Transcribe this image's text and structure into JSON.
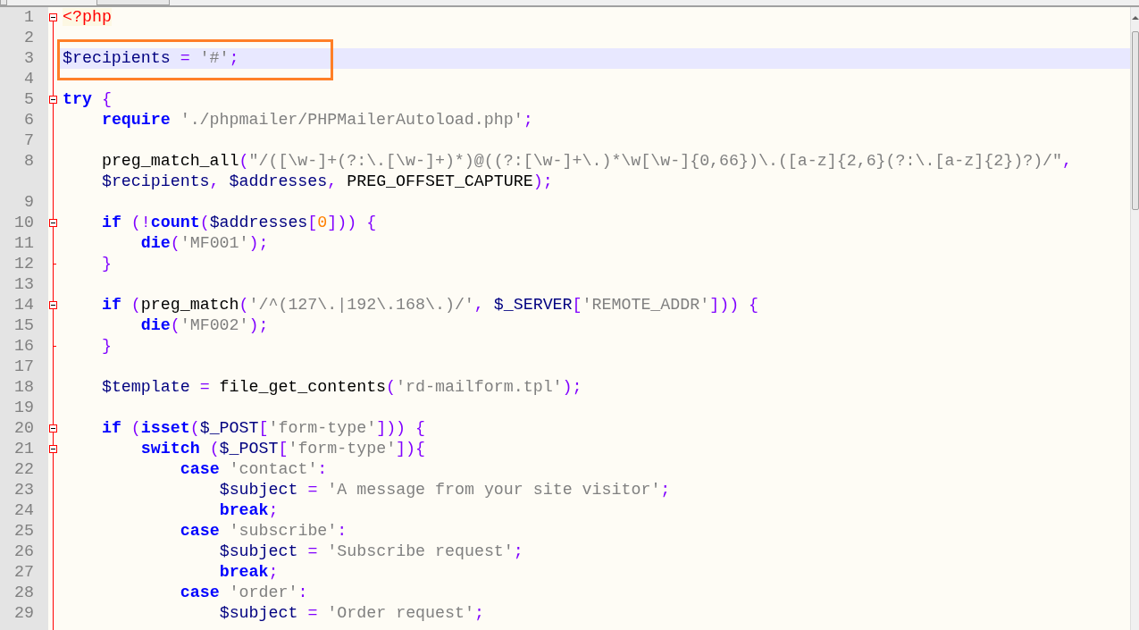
{
  "rows": [
    {
      "number": "1",
      "kind": "fold_start",
      "tokens": [
        {
          "kind": "tag",
          "text": "<?php"
        }
      ]
    },
    {
      "number": "2"
    },
    {
      "number": "3",
      "current": true,
      "boxed": true,
      "tokens": [
        {
          "kind": "var",
          "text": "$recipients"
        },
        {
          "kind": "op",
          "text": " ="
        },
        {
          "kind": "str",
          "text": " '#'"
        },
        {
          "kind": "op",
          "text": ";"
        }
      ]
    },
    {
      "number": "4"
    },
    {
      "number": "5",
      "kind": "fold_start",
      "tokens": [
        {
          "kind": "kw",
          "text": "try"
        },
        {
          "kind": "op",
          "text": " {"
        }
      ],
      "children": [
        {
          "number": "6",
          "tokens": [
            {
              "kind": "kw",
              "text": "require"
            },
            {
              "kind": "str",
              "text": " './phpmailer/PHPMailerAutoload.php'"
            },
            {
              "kind": "op",
              "text": ";"
            }
          ]
        },
        {
          "number": "7"
        },
        {
          "number": "8",
          "tokens": [
            {
              "kind": "plain",
              "text": "preg_match_all"
            },
            {
              "kind": "op",
              "text": "("
            },
            {
              "kind": "str",
              "text": "\"/([\\w-]+(?:\\.[\\w-]+)*)@((?:[\\w-]+\\.)*\\w[\\w-]{0,66})\\.([a-z]{2,6}(?:\\.[a-z]{2})?)/\""
            },
            {
              "kind": "op",
              "text": ","
            }
          ]
        },
        {
          "tokens": [
            {
              "kind": "var",
              "text": "$recipients"
            },
            {
              "kind": "op",
              "text": ","
            },
            {
              "kind": "var",
              "text": " $addresses"
            },
            {
              "kind": "op",
              "text": ","
            },
            {
              "kind": "plain",
              "text": " PREG_OFFSET_CAPTURE"
            },
            {
              "kind": "op",
              "text": ");"
            }
          ]
        },
        {
          "number": "9"
        },
        {
          "number": "10",
          "kind": "fold_start",
          "tokens": [
            {
              "kind": "kw",
              "text": "if"
            },
            {
              "kind": "op",
              "text": " (!"
            },
            {
              "kind": "kw",
              "text": "count"
            },
            {
              "kind": "op",
              "text": "("
            },
            {
              "kind": "var",
              "text": "$addresses"
            },
            {
              "kind": "op",
              "text": "["
            },
            {
              "kind": "num",
              "text": "0"
            },
            {
              "kind": "op",
              "text": "])) {"
            }
          ],
          "children": [
            {
              "number": "11",
              "tokens": [
                {
                  "kind": "kw",
                  "text": "die"
                },
                {
                  "kind": "op",
                  "text": "("
                },
                {
                  "kind": "str",
                  "text": "'MF001'"
                },
                {
                  "kind": "op",
                  "text": ");"
                }
              ]
            }
          ]
        },
        {
          "number": "12",
          "kind": "fold_end",
          "tokens": [
            {
              "kind": "op",
              "text": "}"
            }
          ]
        },
        {
          "number": "13"
        },
        {
          "number": "14",
          "kind": "fold_start",
          "tokens": [
            {
              "kind": "kw",
              "text": "if"
            },
            {
              "kind": "op",
              "text": " ("
            },
            {
              "kind": "plain",
              "text": "preg_match"
            },
            {
              "kind": "op",
              "text": "("
            },
            {
              "kind": "str",
              "text": "'/^(127\\.|192\\.168\\.)/'"
            },
            {
              "kind": "op",
              "text": ","
            },
            {
              "kind": "var",
              "text": " $_SERVER"
            },
            {
              "kind": "op",
              "text": "["
            },
            {
              "kind": "str",
              "text": "'REMOTE_ADDR'"
            },
            {
              "kind": "op",
              "text": "])) {"
            }
          ],
          "children": [
            {
              "number": "15",
              "tokens": [
                {
                  "kind": "kw",
                  "text": "die"
                },
                {
                  "kind": "op",
                  "text": "("
                },
                {
                  "kind": "str",
                  "text": "'MF002'"
                },
                {
                  "kind": "op",
                  "text": ");"
                }
              ]
            }
          ]
        },
        {
          "number": "16",
          "kind": "fold_end",
          "tokens": [
            {
              "kind": "op",
              "text": "}"
            }
          ]
        },
        {
          "number": "17"
        },
        {
          "number": "18",
          "tokens": [
            {
              "kind": "var",
              "text": "$template"
            },
            {
              "kind": "op",
              "text": " ="
            },
            {
              "kind": "plain",
              "text": " file_get_contents"
            },
            {
              "kind": "op",
              "text": "("
            },
            {
              "kind": "str",
              "text": "'rd-mailform.tpl'"
            },
            {
              "kind": "op",
              "text": ");"
            }
          ]
        },
        {
          "number": "19"
        },
        {
          "number": "20",
          "kind": "fold_start",
          "tokens": [
            {
              "kind": "kw",
              "text": "if"
            },
            {
              "kind": "op",
              "text": " ("
            },
            {
              "kind": "kw",
              "text": "isset"
            },
            {
              "kind": "op",
              "text": "("
            },
            {
              "kind": "var",
              "text": "$_POST"
            },
            {
              "kind": "op",
              "text": "["
            },
            {
              "kind": "str",
              "text": "'form-type'"
            },
            {
              "kind": "op",
              "text": "])) {"
            }
          ],
          "children": [
            {
              "number": "21",
              "kind": "fold_start",
              "tokens": [
                {
                  "kind": "kw",
                  "text": "switch"
                },
                {
                  "kind": "op",
                  "text": " ("
                },
                {
                  "kind": "var",
                  "text": "$_POST"
                },
                {
                  "kind": "op",
                  "text": "["
                },
                {
                  "kind": "str",
                  "text": "'form-type'"
                },
                {
                  "kind": "op",
                  "text": "]){"
                }
              ],
              "children": [
                {
                  "number": "22",
                  "tokens": [
                    {
                      "kind": "kw",
                      "text": "case"
                    },
                    {
                      "kind": "str",
                      "text": " 'contact'"
                    },
                    {
                      "kind": "op",
                      "text": ":"
                    }
                  ],
                  "children": [
                    {
                      "number": "23",
                      "tokens": [
                        {
                          "kind": "var",
                          "text": "$subject"
                        },
                        {
                          "kind": "op",
                          "text": " ="
                        },
                        {
                          "kind": "str",
                          "text": " 'A message from your site visitor'"
                        },
                        {
                          "kind": "op",
                          "text": ";"
                        }
                      ]
                    },
                    {
                      "number": "24",
                      "tokens": [
                        {
                          "kind": "kw",
                          "text": "break"
                        },
                        {
                          "kind": "op",
                          "text": ";"
                        }
                      ]
                    }
                  ]
                },
                {
                  "number": "25",
                  "tokens": [
                    {
                      "kind": "kw",
                      "text": "case"
                    },
                    {
                      "kind": "str",
                      "text": " 'subscribe'"
                    },
                    {
                      "kind": "op",
                      "text": ":"
                    }
                  ],
                  "children": [
                    {
                      "number": "26",
                      "tokens": [
                        {
                          "kind": "var",
                          "text": "$subject"
                        },
                        {
                          "kind": "op",
                          "text": " ="
                        },
                        {
                          "kind": "str",
                          "text": " 'Subscribe request'"
                        },
                        {
                          "kind": "op",
                          "text": ";"
                        }
                      ]
                    },
                    {
                      "number": "27",
                      "tokens": [
                        {
                          "kind": "kw",
                          "text": "break"
                        },
                        {
                          "kind": "op",
                          "text": ";"
                        }
                      ]
                    }
                  ]
                },
                {
                  "number": "28",
                  "tokens": [
                    {
                      "kind": "kw",
                      "text": "case"
                    },
                    {
                      "kind": "str",
                      "text": " 'order'"
                    },
                    {
                      "kind": "op",
                      "text": ":"
                    }
                  ],
                  "children": [
                    {
                      "number": "29",
                      "tokens": [
                        {
                          "kind": "var",
                          "text": "$subject"
                        },
                        {
                          "kind": "op",
                          "text": " ="
                        },
                        {
                          "kind": "str",
                          "text": " 'Order request'"
                        },
                        {
                          "kind": "op",
                          "text": ";"
                        }
                      ]
                    }
                  ]
                }
              ]
            }
          ]
        }
      ]
    }
  ]
}
